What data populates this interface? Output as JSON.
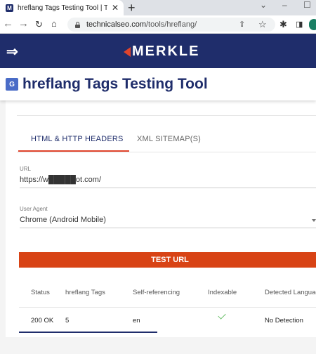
{
  "browser": {
    "tab_title": "hreflang Tags Testing Tool | Techni",
    "favicon_letter": "M",
    "close_glyph": "✕",
    "new_tab_glyph": "+",
    "url_host": "technicalseo.com",
    "url_path": "/tools/hreflang/",
    "icons": [
      "back-icon",
      "forward-icon",
      "reload-icon",
      "home-icon",
      "lock-icon",
      "share-icon",
      "star-icon",
      "extensions-icon",
      "sidepanel-icon"
    ]
  },
  "site": {
    "brand": "MERKLE",
    "brand_color": "#1f2d6b",
    "accent_color": "#e0442c"
  },
  "page": {
    "title": "hreflang Tags Testing Tool"
  },
  "tabs": [
    {
      "label": "HTML & HTTP HEADERS",
      "active": true
    },
    {
      "label": "XML SITEMAP(S)",
      "active": false
    }
  ],
  "form": {
    "url_label": "URL",
    "url_value": "https://w█████ot.com/",
    "agent_label": "User Agent",
    "agent_value": "Chrome (Android Mobile)",
    "button_label": "TEST URL"
  },
  "results": {
    "columns": [
      "Status",
      "hreflang Tags",
      "Self-referencing",
      "Indexable",
      "Detected Languag"
    ],
    "rows": [
      {
        "status": "200 OK",
        "hreflang_tags": "5",
        "self_referencing": "en",
        "indexable": "check-icon",
        "detected_language": "No Detection"
      }
    ]
  }
}
